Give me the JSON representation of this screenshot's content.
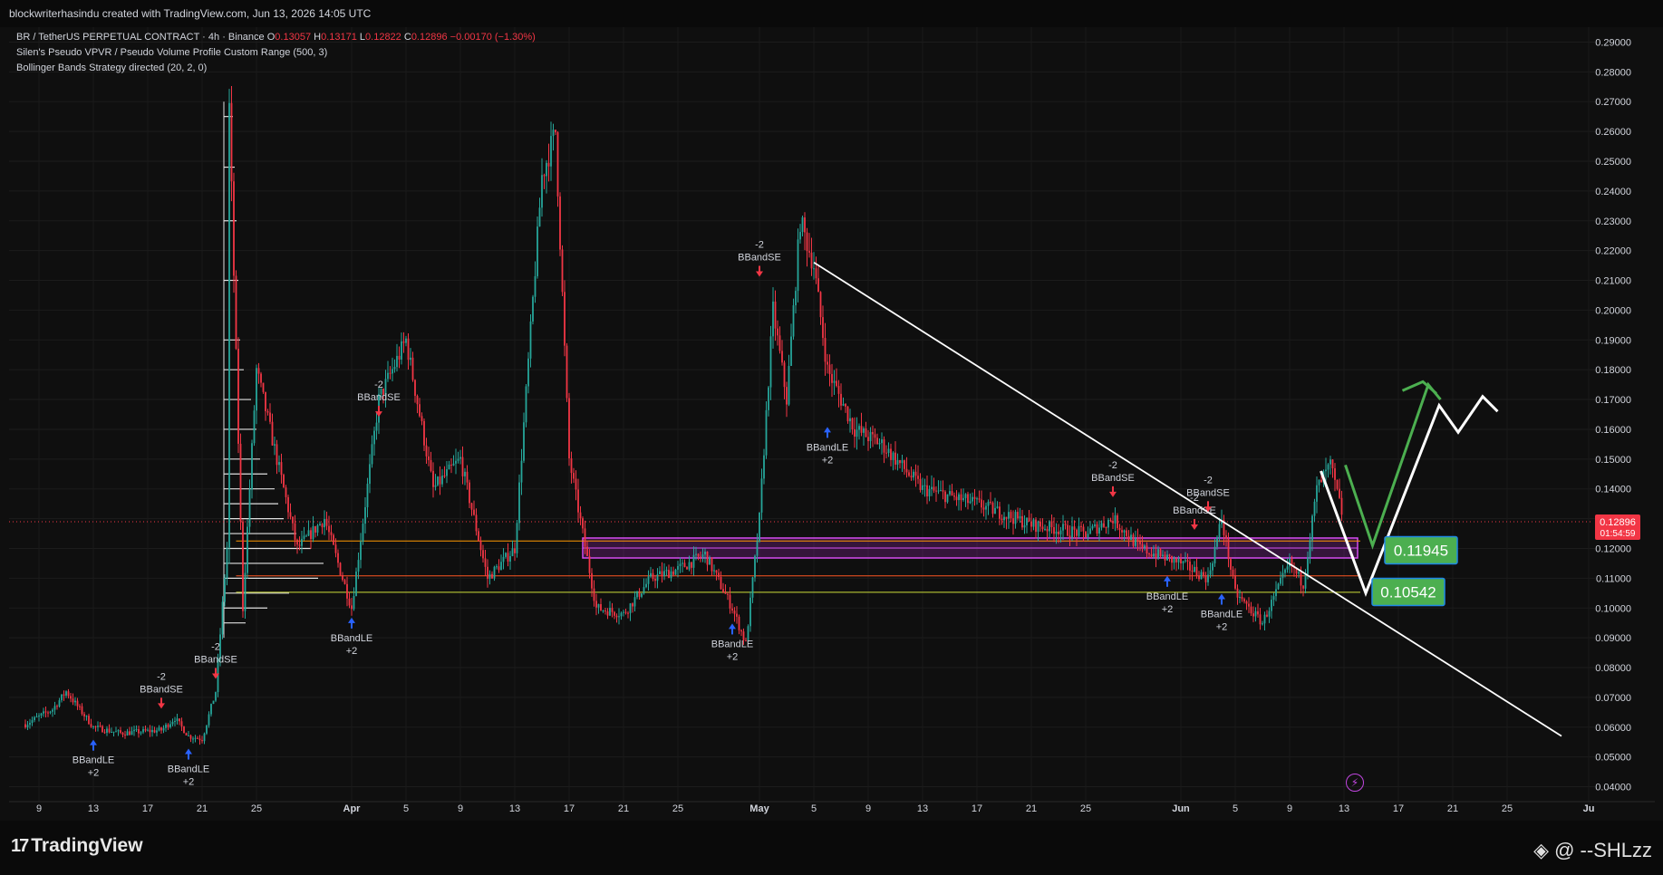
{
  "header": {
    "credit": "blockwriterhasindu created with TradingView.com, Jun 13, 2026 14:05 UTC"
  },
  "legend": {
    "symbol": "BR / TetherUS PERPETUAL CONTRACT · 4h · Binance",
    "open_label": "O",
    "open": "0.13057",
    "high_label": "H",
    "high": "0.13171",
    "low_label": "L",
    "low": "0.12822",
    "close_label": "C",
    "close": "0.12896",
    "change": "−0.00170 (−1.30%)",
    "vpvr": "Silen's Pseudo VPVR / Pseudo Volume Profile Custom Range (500, 3)",
    "bollinger": "Bollinger Bands Strategy directed (20, 2, 0)"
  },
  "price_tag": {
    "price": "0.12896",
    "countdown": "01:54:59",
    "color": "#f23645"
  },
  "level_boxes": [
    {
      "value": "0.11945",
      "color": "#4caf50"
    },
    {
      "value": "0.10542",
      "color": "#4caf50"
    }
  ],
  "footer": {
    "brand": "TradingView",
    "author": "@ --SHLzz"
  },
  "colors": {
    "up": "#26a69a",
    "down": "#f23645",
    "background": "#0f0f0f",
    "zone": "#9c27b0",
    "trendline": "#ffffff",
    "projection_up": "#4caf50"
  },
  "chart_data": {
    "type": "candlestick",
    "title": "BR / TetherUS PERPETUAL CONTRACT · 4h · Binance",
    "y_axis": {
      "ticks": [
        "0.29000",
        "0.28000",
        "0.27000",
        "0.26000",
        "0.25000",
        "0.24000",
        "0.23000",
        "0.22000",
        "0.21000",
        "0.20000",
        "0.19000",
        "0.18000",
        "0.17000",
        "0.16000",
        "0.15000",
        "0.14000",
        "0.13000",
        "0.12000",
        "0.11000",
        "0.10000",
        "0.09000",
        "0.08000",
        "0.07000",
        "0.06000",
        "0.05000",
        "0.04000"
      ],
      "ylim": [
        0.035,
        0.295
      ]
    },
    "x_axis": {
      "ticks": [
        "9",
        "13",
        "17",
        "21",
        "25",
        "Apr",
        "5",
        "9",
        "13",
        "17",
        "21",
        "25",
        "May",
        "5",
        "9",
        "13",
        "17",
        "21",
        "25",
        "Jun",
        "5",
        "9",
        "13",
        "17",
        "21",
        "25",
        "Ju"
      ]
    },
    "current_price": 0.12896,
    "price_path": [
      [
        "Mar 8",
        0.061
      ],
      [
        "Mar 10",
        0.066
      ],
      [
        "Mar 11",
        0.072
      ],
      [
        "Mar 13",
        0.06
      ],
      [
        "Mar 15",
        0.058
      ],
      [
        "Mar 18",
        0.059
      ],
      [
        "Mar 19",
        0.063
      ],
      [
        "Mar 20",
        0.057
      ],
      [
        "Mar 21",
        0.056
      ],
      [
        "Mar 22",
        0.072
      ],
      [
        "Mar 23",
        0.13
      ],
      [
        "Mar 23",
        0.268
      ],
      [
        "Mar 24",
        0.1
      ],
      [
        "Mar 25",
        0.18
      ],
      [
        "Mar 26",
        0.16
      ],
      [
        "Mar 28",
        0.12
      ],
      [
        "Mar 30",
        0.13
      ],
      [
        "Apr 1",
        0.1
      ],
      [
        "Apr 3",
        0.17
      ],
      [
        "Apr 5",
        0.19
      ],
      [
        "Apr 7",
        0.14
      ],
      [
        "Apr 9",
        0.15
      ],
      [
        "Apr 11",
        0.11
      ],
      [
        "Apr 13",
        0.12
      ],
      [
        "Apr 15",
        0.245
      ],
      [
        "Apr 16",
        0.26
      ],
      [
        "Apr 17",
        0.15
      ],
      [
        "Apr 19",
        0.1
      ],
      [
        "Apr 21",
        0.098
      ],
      [
        "Apr 23",
        0.11
      ],
      [
        "Apr 25",
        0.113
      ],
      [
        "Apr 27",
        0.118
      ],
      [
        "Apr 29",
        0.1
      ],
      [
        "Apr 30",
        0.088
      ],
      [
        "May 1",
        0.13
      ],
      [
        "May 2",
        0.2
      ],
      [
        "May 3",
        0.17
      ],
      [
        "May 4",
        0.23
      ],
      [
        "May 5",
        0.215
      ],
      [
        "May 6",
        0.18
      ],
      [
        "May 8",
        0.16
      ],
      [
        "May 10",
        0.155
      ],
      [
        "May 13",
        0.14
      ],
      [
        "May 17",
        0.135
      ],
      [
        "May 21",
        0.128
      ],
      [
        "May 25",
        0.125
      ],
      [
        "May 27",
        0.13
      ],
      [
        "May 29",
        0.12
      ],
      [
        "Jun 1",
        0.115
      ],
      [
        "Jun 3",
        0.11
      ],
      [
        "Jun 4",
        0.13
      ],
      [
        "Jun 5",
        0.105
      ],
      [
        "Jun 7",
        0.095
      ],
      [
        "Jun 9",
        0.115
      ],
      [
        "Jun 10",
        0.108
      ],
      [
        "Jun 11",
        0.14
      ],
      [
        "Jun 12",
        0.148
      ],
      [
        "Jun 13",
        0.12896
      ]
    ],
    "horizontal_levels": [
      {
        "value": 0.1225,
        "color": "#ff9800"
      },
      {
        "value": 0.1108,
        "color": "#ff5722"
      },
      {
        "value": 0.1053,
        "color": "#cddc39"
      }
    ],
    "zones": [
      {
        "from": 0.1168,
        "to": 0.1235,
        "color": "#9c27b0",
        "start": "Apr 18",
        "end": "Jun 14"
      }
    ],
    "trendline": {
      "from": [
        "May 5",
        0.216
      ],
      "to": [
        "Jun 29",
        0.057
      ]
    },
    "signals": [
      {
        "label": "BBandLE",
        "extra": "+2",
        "date": "Mar 13",
        "price": 0.057,
        "dir": "up"
      },
      {
        "label": "BBandSE",
        "extra": "-2",
        "date": "Mar 18",
        "price": 0.065,
        "dir": "down"
      },
      {
        "label": "BBandLE",
        "extra": "+2",
        "date": "Mar 20",
        "price": 0.054,
        "dir": "up"
      },
      {
        "label": "BBandSE",
        "extra": "-2",
        "date": "Mar 22",
        "price": 0.075,
        "dir": "down"
      },
      {
        "label": "BBandSE",
        "extra": "-2",
        "date": "Apr 3",
        "price": 0.163,
        "dir": "down"
      },
      {
        "label": "BBandLE",
        "extra": "+2",
        "date": "Apr 1",
        "price": 0.098,
        "dir": "up"
      },
      {
        "label": "BBandLE",
        "extra": "+2",
        "date": "Apr 29",
        "price": 0.096,
        "dir": "up"
      },
      {
        "label": "BBandSE",
        "extra": "-2",
        "date": "May 1",
        "price": 0.21,
        "dir": "down"
      },
      {
        "label": "BBandLE",
        "extra": "+2",
        "date": "May 6",
        "price": 0.162,
        "dir": "up"
      },
      {
        "label": "BBandSE",
        "extra": "-2",
        "date": "May 27",
        "price": 0.136,
        "dir": "down"
      },
      {
        "label": "BBandLE",
        "extra": "+2",
        "date": "May 31",
        "price": 0.112,
        "dir": "up"
      },
      {
        "label": "BBandSE",
        "extra": "-2",
        "date": "Jun 2",
        "price": 0.125,
        "dir": "down"
      },
      {
        "label": "BBandSE",
        "extra": "-2",
        "date": "Jun 3",
        "price": 0.131,
        "dir": "down"
      },
      {
        "label": "BBandLE",
        "extra": "+2",
        "date": "Jun 4",
        "price": 0.106,
        "dir": "up"
      }
    ]
  }
}
